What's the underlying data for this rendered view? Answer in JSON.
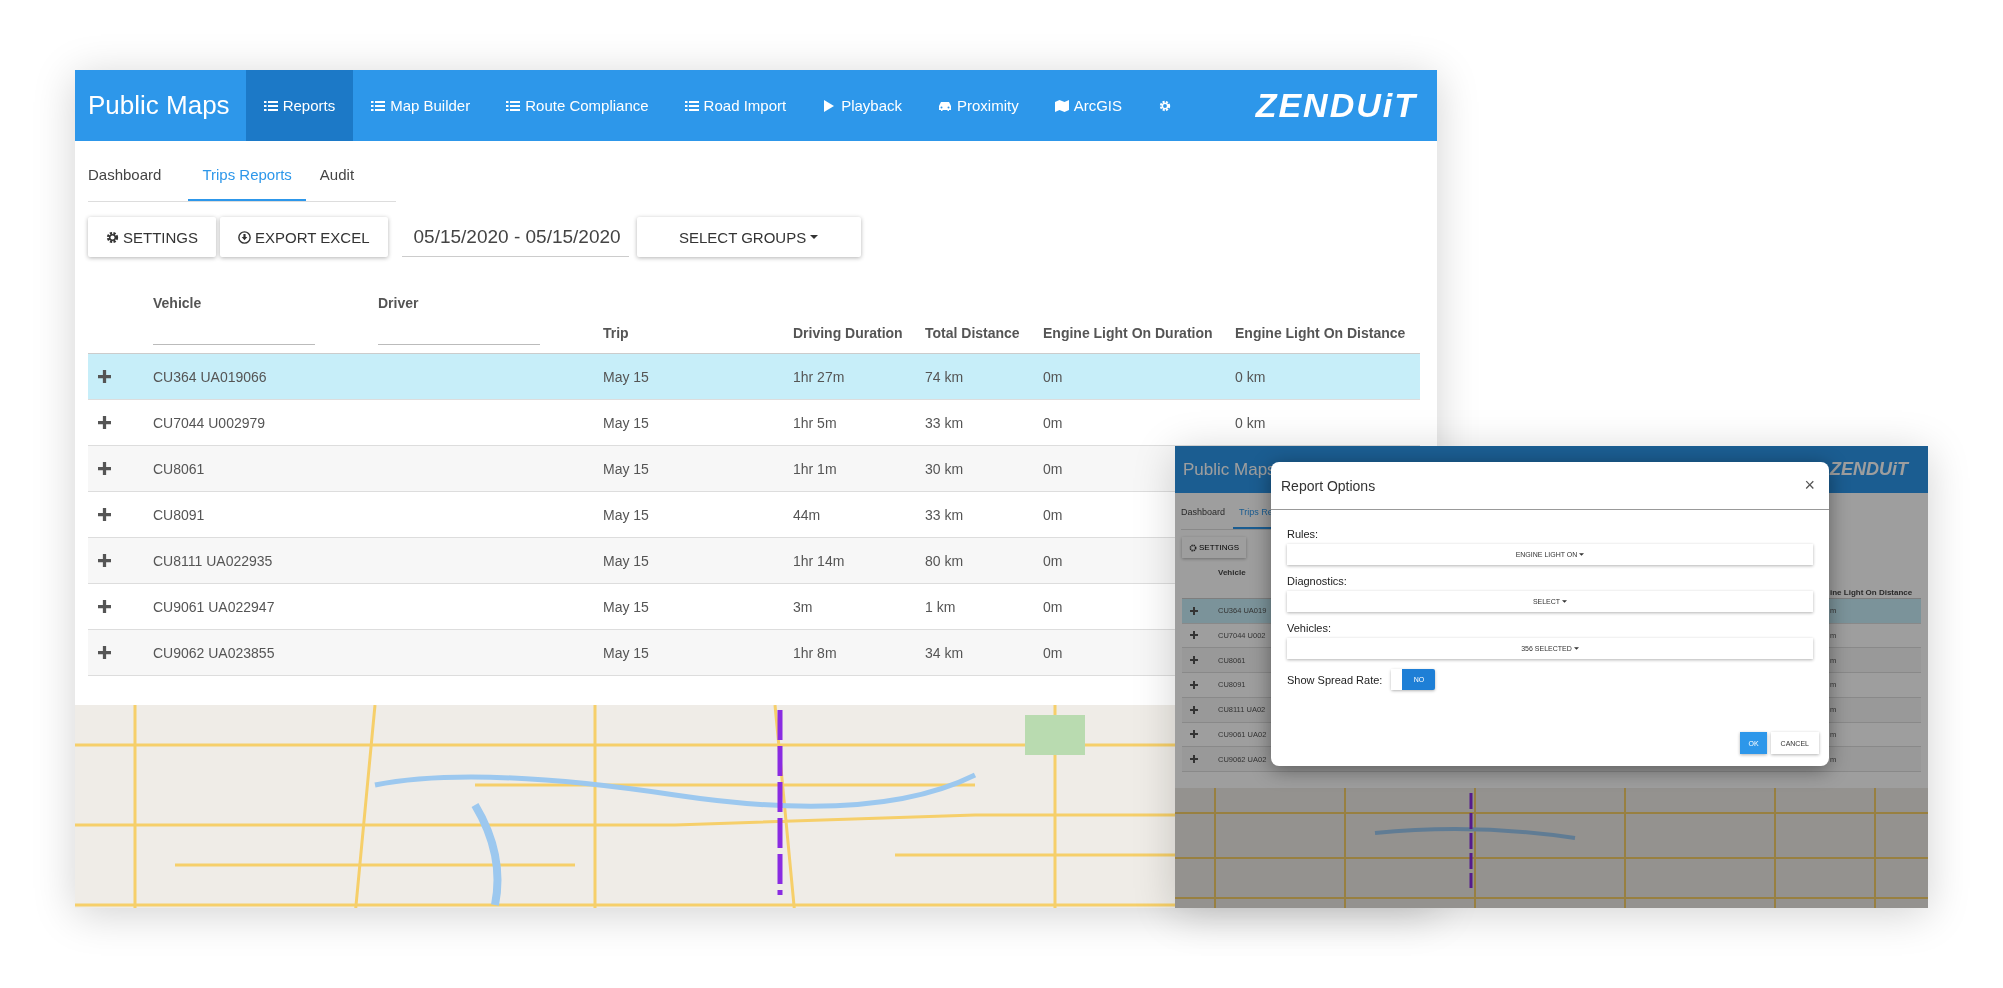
{
  "main_window": {
    "brand": "Public Maps",
    "nav": [
      {
        "label": "Reports",
        "selected": true
      },
      {
        "label": "Map Builder",
        "selected": false
      },
      {
        "label": "Route Compliance",
        "selected": false
      },
      {
        "label": "Road Import",
        "selected": false
      },
      {
        "label": "Playback",
        "selected": false
      },
      {
        "label": "Proximity",
        "selected": false
      },
      {
        "label": "ArcGIS",
        "selected": false
      },
      {
        "selected": false
      }
    ],
    "logo": "ZENDUiT",
    "subtabs": [
      {
        "label": "Dashboard",
        "selected": false
      },
      {
        "label": "Trips Reports",
        "selected": true
      },
      {
        "label": "Audit",
        "selected": false
      }
    ],
    "toolbar": {
      "settings_button": "SETTINGS",
      "export_button": "EXPORT EXCEL",
      "date_range": "05/15/2020 - 05/15/2020",
      "groups_button": "SELECT GROUPS"
    },
    "table": {
      "columns": [
        {
          "label": "Vehicle",
          "kind": "filter"
        },
        {
          "label": "Driver",
          "kind": "filter"
        },
        {
          "label": "Trip",
          "kind": "plain"
        },
        {
          "label": "Driving Duration",
          "kind": "plain"
        },
        {
          "label": "Total Distance",
          "kind": "plain"
        },
        {
          "label": "Engine Light On Duration",
          "kind": "plain"
        },
        {
          "label": "Engine Light On Distance",
          "kind": "plain"
        }
      ],
      "rows": [
        {
          "selected": true,
          "vehicle": "CU364 UA019066",
          "trip": "May 15",
          "driving_duration": "1hr 27m",
          "total_distance": "74 km",
          "engine_light_on_duration": "0m",
          "engine_light_on_distance": "0 km"
        },
        {
          "selected": false,
          "vehicle": "CU7044 U002979",
          "trip": "May 15",
          "driving_duration": "1hr 5m",
          "total_distance": "33 km",
          "engine_light_on_duration": "0m",
          "engine_light_on_distance": "0 km"
        },
        {
          "selected": false,
          "vehicle": "CU8061",
          "trip": "May 15",
          "driving_duration": "1hr 1m",
          "total_distance": "30 km",
          "engine_light_on_duration": "0m"
        },
        {
          "selected": false,
          "vehicle": "CU8091",
          "trip": "May 15",
          "driving_duration": "44m",
          "total_distance": "33 km",
          "engine_light_on_duration": "0m"
        },
        {
          "selected": false,
          "vehicle": "CU8111 UA022935",
          "trip": "May 15",
          "driving_duration": "1hr 14m",
          "total_distance": "80 km",
          "engine_light_on_duration": "0m"
        },
        {
          "selected": false,
          "vehicle": "CU9061 UA022947",
          "trip": "May 15",
          "driving_duration": "3m",
          "total_distance": "1 km",
          "engine_light_on_duration": "0m"
        },
        {
          "selected": false,
          "vehicle": "CU9062 UA023855",
          "trip": "May 15",
          "driving_duration": "1hr 8m",
          "total_distance": "34 km",
          "engine_light_on_duration": "0m"
        }
      ]
    }
  },
  "inset_window": {
    "brand": "Public Maps",
    "logo": "ZENDUiT",
    "subtabs": [
      {
        "label": "Dashboard",
        "selected": false
      },
      {
        "label": "Trips Re",
        "selected": true
      }
    ],
    "settings_button": "SETTINGS",
    "vehicle_header": "Vehicle",
    "last_header": "ine Light On Distance",
    "rows": [
      {
        "selected": true,
        "vehicle": "CU364 UA019",
        "last": "m"
      },
      {
        "selected": false,
        "vehicle": "CU7044 U002",
        "last": "m"
      },
      {
        "selected": false,
        "vehicle": "CU8061",
        "last": "m"
      },
      {
        "selected": false,
        "vehicle": "CU8091",
        "last": "m"
      },
      {
        "selected": false,
        "vehicle": "CU8111 UA02",
        "last": "m"
      },
      {
        "selected": false,
        "vehicle": "CU9061 UA02",
        "last": "m"
      },
      {
        "selected": false,
        "vehicle": "CU9062 UA02",
        "last": "m"
      }
    ],
    "dialog": {
      "title": "Report Options",
      "close": "×",
      "fields": [
        {
          "label": "Rules:",
          "value": "ENGINE LIGHT ON"
        },
        {
          "label": "Diagnostics:",
          "value": "SELECT"
        },
        {
          "label": "Vehicles:",
          "value": "356 SELECTED"
        }
      ],
      "spread_rate": {
        "label": "Show Spread Rate:",
        "on": false,
        "text": "NO"
      },
      "buttons": [
        {
          "label": "OK",
          "kind": "primary"
        },
        {
          "label": "CANCEL",
          "kind": "secondary"
        }
      ]
    }
  }
}
